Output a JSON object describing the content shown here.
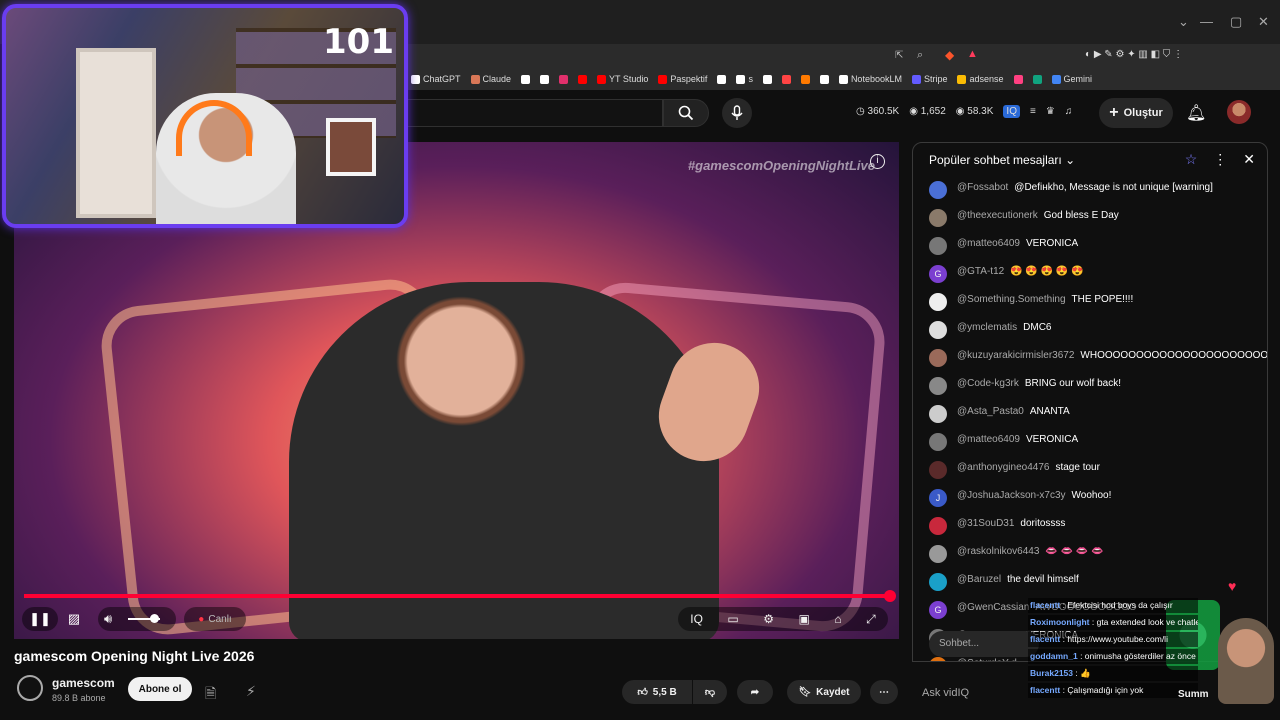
{
  "webcam": {
    "viewer_count": "101"
  },
  "bookmarks": [
    {
      "label": "ChatGPT",
      "color": "#ffffff"
    },
    {
      "label": "Claude",
      "color": "#d97757"
    },
    {
      "label": "",
      "color": "#ffffff"
    },
    {
      "label": "",
      "color": "#ffffff"
    },
    {
      "label": "",
      "color": "#e1306c"
    },
    {
      "label": "",
      "color": "#ff0000"
    },
    {
      "label": "YT Studio",
      "color": "#ff0000"
    },
    {
      "label": "Paspektif",
      "color": "#ff0000"
    },
    {
      "label": "",
      "color": "#ffffff"
    },
    {
      "label": "s",
      "color": "#ffffff"
    },
    {
      "label": "",
      "color": "#ffffff"
    },
    {
      "label": "",
      "color": "#ff4444"
    },
    {
      "label": "",
      "color": "#ff7a00"
    },
    {
      "label": "",
      "color": "#ffffff"
    },
    {
      "label": "NotebookLM",
      "color": "#ffffff"
    },
    {
      "label": "Stripe",
      "color": "#635bff"
    },
    {
      "label": "adsense",
      "color": "#fbbc04"
    },
    {
      "label": "",
      "color": "#ff4081"
    },
    {
      "label": "",
      "color": "#10a37f"
    },
    {
      "label": "Gemini",
      "color": "#4285f4"
    }
  ],
  "header": {
    "stats": [
      {
        "icon": "clock-icon",
        "value": "360.5K"
      },
      {
        "icon": "eye-icon",
        "value": "1,652"
      },
      {
        "icon": "eye-icon",
        "value": "58.3K"
      }
    ],
    "create_label": "Oluştur"
  },
  "player": {
    "hashtag": "#gamescomOpeningNightLive",
    "live_label": "Canlı",
    "progress_fraction": 1.0
  },
  "video": {
    "title": "gamescom Opening Night Live 2026",
    "channel": "gamescom",
    "subscribers": "89.8 B abone",
    "subscribe_label": "Abone ol",
    "like_count": "5,5 B",
    "save_label": "Kaydet"
  },
  "chat": {
    "header": "Popüler sohbet mesajları",
    "input_placeholder": "Sohbet...",
    "messages": [
      {
        "user": "@Fossabot",
        "text": "@Defінkho, Message is not unique [warning]",
        "avatar": "",
        "color": "#4a6fd6"
      },
      {
        "user": "@theexecutionerk",
        "text": "God bless E Day",
        "avatar": "",
        "color": "#8a7a6a"
      },
      {
        "user": "@matteo6409",
        "text": "VERONICA",
        "avatar": "",
        "color": "#777777"
      },
      {
        "user": "@GTA-t12",
        "text": "😍 😍 😍 😍 😍",
        "avatar": "G",
        "color": "#7b3fd0"
      },
      {
        "user": "@Something.Something",
        "text": "THE POPE!!!!",
        "avatar": "",
        "color": "#eeeeee"
      },
      {
        "user": "@ymclematis",
        "text": "DMC6",
        "avatar": "",
        "color": "#dddddd"
      },
      {
        "user": "@kuzuyarakicirmisler3672",
        "text": "WHOOOOOOOOOOOOOOOOOOOOOOOOO",
        "avatar": "",
        "color": "#9a6a5a"
      },
      {
        "user": "@Code-kg3rk",
        "text": "BRING our wolf back!",
        "avatar": "",
        "color": "#888888"
      },
      {
        "user": "@Asta_Pasta0",
        "text": "ANANTA",
        "avatar": "",
        "color": "#cccccc"
      },
      {
        "user": "@matteo6409",
        "text": "VERONICA",
        "avatar": "",
        "color": "#777777"
      },
      {
        "user": "@anthonygineo4476",
        "text": "stage tour",
        "avatar": "",
        "color": "#5a2a2a"
      },
      {
        "user": "@JoshuaJackson-x7c3y",
        "text": "Woohoo!",
        "avatar": "J",
        "color": "#3a5ac8"
      },
      {
        "user": "@31SouD31",
        "text": "doritossss",
        "avatar": "",
        "color": "#c8283c"
      },
      {
        "user": "@raskolnikov6443",
        "text": "👄 👄 👄 👄",
        "avatar": "",
        "color": "#999999"
      },
      {
        "user": "@Baruzel",
        "text": "the devil himself",
        "avatar": "",
        "color": "#1aa0c8"
      },
      {
        "user": "@GwenCassian",
        "text": "AWOOOOOOOOOOO",
        "avatar": "G",
        "color": "#7b3fd0"
      },
      {
        "user": "@matteo6409",
        "text": "VERONICA",
        "avatar": "",
        "color": "#777777"
      },
      {
        "user": "@SaturdaY-d",
        "text": "",
        "avatar": "D",
        "color": "#e07010"
      }
    ]
  },
  "overlay": {
    "lines": [
      {
        "user": "flacentt",
        "text": "Efektcisi hod boys da çalışır"
      },
      {
        "user": "Roximoonlight",
        "text": "gta extended look ve chatle birlikte izlemiş olursunuz"
      },
      {
        "user": "flacentt",
        "text": "https://www.youtube.com/li"
      },
      {
        "user": "goddamn_1",
        "text": "onimusha gösterdiler az önce"
      },
      {
        "user": "Burak2153",
        "text": "👍"
      },
      {
        "user": "flacentt",
        "text": "Çalışmadığı için yok"
      }
    ]
  },
  "footer": {
    "ask_placeholder": "Ask vidIQ",
    "summary_label": "Summ"
  }
}
